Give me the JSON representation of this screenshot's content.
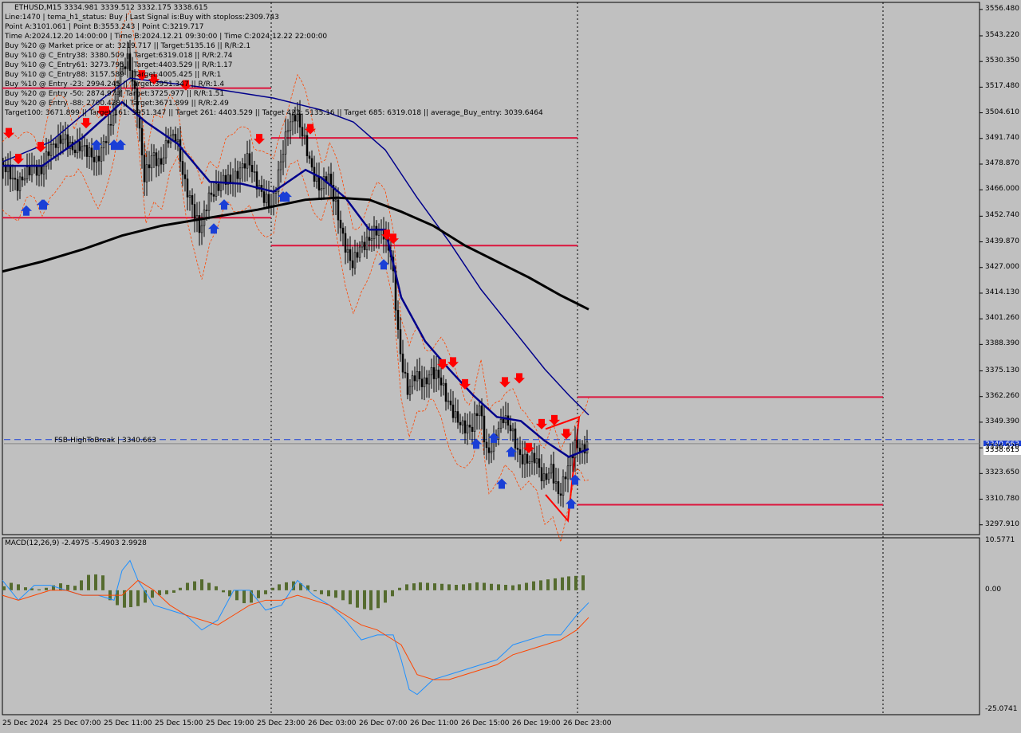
{
  "header": {
    "symbol_line": "ETHUSD,M15  3334.981 3339.512 3332.175 3338.615",
    "info_lines": [
      "Line:1470 | tema_h1_status: Buy | Last Signal is:Buy with stoploss:2309.743",
      "Point A:3101.061 | Point B:3553.243 | Point C:3219.717",
      "Time A:2024.12.20 14:00:00 | Time B:2024.12.21 09:30:00 | Time C:2024.12.22 22:00:00",
      "Buy %20 @ Market price or at: 3219.717 || Target:5135.16 || R/R:2.1",
      "Buy %10 @ C_Entry38: 3380.509 || Target:6319.018 || R/R:2.74",
      "Buy %10 @ C_Entry61: 3273.795 || Target:4403.529 || R/R:1.17",
      "Buy %10 @ C_Entry88: 3157.589 || Target:4005.425 || R/R:1",
      "Buy %10 @ Entry -23: 2994.245 || Target:3951.347 || R/R:1.4",
      "Buy %20 @ Entry -50: 2874.97 || Target:3725.977 || R/R:1.51",
      "Buy %20 @ Entry -88: 2700.428 || Target:3671.899 || R/R:2.49",
      "Target100: 3671.899 || Target 161: 3951.347 || Target 261: 4403.529 || Target 423: 5135.16 || Target 685: 6319.018 || average_Buy_entry: 3039.6464"
    ]
  },
  "macd_label": "MACD(12,26,9) -2.4975 -5.4903 2.9928",
  "hline_label": "FSB-HighToBreak | 3340.663",
  "price_tags": {
    "fsb": "3340.663",
    "current": "3338.615"
  },
  "colors": {
    "background": "#c0c0c0",
    "candles": "#000000",
    "ema_fast": "#00008b",
    "ema_slow": "#000000",
    "envelope": "#ff4500",
    "levels": "#dc143c",
    "fsb_line": "#1a3fd6",
    "macd_hist": "#556b2f",
    "macd_line": "#1e90ff",
    "signal_line": "#ff4500",
    "arrow_buy": "#1a3fd6",
    "arrow_sell": "#ff0000"
  },
  "chart_data": {
    "type": "candlestick",
    "symbol": "ETHUSD",
    "timeframe": "M15",
    "price_axis_ticks": [
      "3556.480",
      "3543.220",
      "3530.350",
      "3517.480",
      "3504.610",
      "3491.740",
      "3478.870",
      "3466.000",
      "3452.740",
      "3439.870",
      "3427.000",
      "3414.130",
      "3401.260",
      "3388.390",
      "3375.130",
      "3362.260",
      "3349.390",
      "3336.520",
      "3323.650",
      "3310.780",
      "3297.910"
    ],
    "price_range": [
      3293,
      3560
    ],
    "time_axis_ticks": [
      "25 Dec 2024",
      "25 Dec 07:00",
      "25 Dec 11:00",
      "25 Dec 15:00",
      "25 Dec 19:00",
      "25 Dec 23:00",
      "26 Dec 03:00",
      "26 Dec 07:00",
      "26 Dec 11:00",
      "26 Dec 15:00",
      "26 Dec 19:00",
      "26 Dec 23:00"
    ],
    "price_path": [
      [
        0,
        3480
      ],
      [
        10,
        3475
      ],
      [
        20,
        3468
      ],
      [
        30,
        3473
      ],
      [
        40,
        3478
      ],
      [
        50,
        3474
      ],
      [
        60,
        3486
      ],
      [
        70,
        3490
      ],
      [
        80,
        3492
      ],
      [
        90,
        3486
      ],
      [
        100,
        3488
      ],
      [
        110,
        3485
      ],
      [
        120,
        3480
      ],
      [
        130,
        3490
      ],
      [
        140,
        3502
      ],
      [
        150,
        3525
      ],
      [
        160,
        3532
      ],
      [
        170,
        3510
      ],
      [
        180,
        3472
      ],
      [
        190,
        3484
      ],
      [
        200,
        3478
      ],
      [
        210,
        3492
      ],
      [
        220,
        3493
      ],
      [
        230,
        3470
      ],
      [
        240,
        3458
      ],
      [
        250,
        3445
      ],
      [
        260,
        3462
      ],
      [
        270,
        3466
      ],
      [
        280,
        3472
      ],
      [
        290,
        3470
      ],
      [
        300,
        3476
      ],
      [
        310,
        3482
      ],
      [
        320,
        3470
      ],
      [
        330,
        3462
      ],
      [
        340,
        3458
      ],
      [
        350,
        3478
      ],
      [
        360,
        3498
      ],
      [
        370,
        3504
      ],
      [
        380,
        3492
      ],
      [
        390,
        3476
      ],
      [
        400,
        3466
      ],
      [
        410,
        3474
      ],
      [
        420,
        3458
      ],
      [
        430,
        3440
      ],
      [
        440,
        3428
      ],
      [
        450,
        3437
      ],
      [
        460,
        3440
      ],
      [
        470,
        3446
      ],
      [
        480,
        3444
      ],
      [
        490,
        3432
      ],
      [
        500,
        3385
      ],
      [
        510,
        3365
      ],
      [
        520,
        3374
      ],
      [
        530,
        3368
      ],
      [
        540,
        3375
      ],
      [
        550,
        3372
      ],
      [
        560,
        3360
      ],
      [
        570,
        3352
      ],
      [
        580,
        3347
      ],
      [
        590,
        3346
      ],
      [
        600,
        3358
      ],
      [
        610,
        3332
      ],
      [
        620,
        3342
      ],
      [
        630,
        3352
      ],
      [
        640,
        3346
      ],
      [
        650,
        3332
      ],
      [
        660,
        3330
      ],
      [
        670,
        3332
      ],
      [
        680,
        3320
      ],
      [
        690,
        3326
      ],
      [
        700,
        3312
      ],
      [
        710,
        3326
      ],
      [
        720,
        3338
      ],
      [
        730,
        3335
      ],
      [
        735,
        3338.615
      ]
    ],
    "levels": [
      3517,
      3492,
      3452,
      3438,
      3362,
      3308
    ],
    "fsb_high_to_break": 3340.663,
    "current_price": 3338.615,
    "ema_fast_path": [
      [
        0,
        3478
      ],
      [
        50,
        3478
      ],
      [
        100,
        3492
      ],
      [
        150,
        3510
      ],
      [
        180,
        3500
      ],
      [
        220,
        3489
      ],
      [
        260,
        3470
      ],
      [
        300,
        3469
      ],
      [
        340,
        3465
      ],
      [
        380,
        3476
      ],
      [
        400,
        3472
      ],
      [
        430,
        3462
      ],
      [
        460,
        3446
      ],
      [
        480,
        3446
      ],
      [
        500,
        3412
      ],
      [
        530,
        3390
      ],
      [
        560,
        3376
      ],
      [
        590,
        3363
      ],
      [
        620,
        3352
      ],
      [
        650,
        3350
      ],
      [
        680,
        3340
      ],
      [
        710,
        3332
      ],
      [
        735,
        3336
      ]
    ],
    "ema_slow_path": [
      [
        0,
        3425
      ],
      [
        50,
        3430
      ],
      [
        100,
        3436
      ],
      [
        150,
        3443
      ],
      [
        200,
        3448
      ],
      [
        260,
        3452
      ],
      [
        320,
        3456
      ],
      [
        380,
        3461
      ],
      [
        420,
        3462
      ],
      [
        460,
        3461
      ],
      [
        500,
        3455
      ],
      [
        540,
        3448
      ],
      [
        580,
        3438
      ],
      [
        620,
        3430
      ],
      [
        660,
        3422
      ],
      [
        700,
        3413
      ],
      [
        735,
        3406
      ]
    ],
    "ema_mid_path": [
      [
        0,
        3480
      ],
      [
        60,
        3490
      ],
      [
        120,
        3510
      ],
      [
        160,
        3522
      ],
      [
        200,
        3520
      ],
      [
        260,
        3517
      ],
      [
        340,
        3512
      ],
      [
        400,
        3506
      ],
      [
        440,
        3500
      ],
      [
        480,
        3486
      ],
      [
        520,
        3462
      ],
      [
        560,
        3440
      ],
      [
        600,
        3416
      ],
      [
        640,
        3396
      ],
      [
        680,
        3376
      ],
      [
        710,
        3363
      ],
      [
        735,
        3353
      ]
    ],
    "sell_arrows": [
      [
        8,
        3493
      ],
      [
        20,
        3480
      ],
      [
        48,
        3486
      ],
      [
        105,
        3498
      ],
      [
        125,
        3504
      ],
      [
        130,
        3504
      ],
      [
        175,
        3522
      ],
      [
        190,
        3520
      ],
      [
        230,
        3517
      ],
      [
        322,
        3490
      ],
      [
        386,
        3495
      ],
      [
        482,
        3442
      ],
      [
        490,
        3440
      ],
      [
        552,
        3377
      ],
      [
        565,
        3378
      ],
      [
        580,
        3367
      ],
      [
        630,
        3368
      ],
      [
        648,
        3370
      ],
      [
        660,
        3335
      ],
      [
        676,
        3347
      ],
      [
        692,
        3349
      ],
      [
        707,
        3342
      ]
    ],
    "buy_arrows": [
      [
        30,
        3457
      ],
      [
        50,
        3460
      ],
      [
        52,
        3460
      ],
      [
        118,
        3490
      ],
      [
        140,
        3490
      ],
      [
        148,
        3490
      ],
      [
        265,
        3448
      ],
      [
        278,
        3460
      ],
      [
        352,
        3464
      ],
      [
        356,
        3464
      ],
      [
        478,
        3430
      ],
      [
        594,
        3340
      ],
      [
        616,
        3343
      ],
      [
        626,
        3320
      ],
      [
        638,
        3336
      ],
      [
        713,
        3310
      ],
      [
        718,
        3322
      ]
    ],
    "macd": {
      "ylim": [
        -25.0741,
        10.5771
      ],
      "axis_ticks": [
        "10.5771",
        "0.00",
        "-25.0741"
      ],
      "macd_path": [
        [
          0,
          2
        ],
        [
          20,
          -2
        ],
        [
          40,
          1
        ],
        [
          60,
          1
        ],
        [
          80,
          0
        ],
        [
          100,
          -1
        ],
        [
          120,
          -1
        ],
        [
          140,
          -2
        ],
        [
          150,
          4
        ],
        [
          160,
          6
        ],
        [
          170,
          2
        ],
        [
          190,
          -3
        ],
        [
          210,
          -4
        ],
        [
          230,
          -5
        ],
        [
          250,
          -8
        ],
        [
          270,
          -6
        ],
        [
          290,
          0
        ],
        [
          310,
          0
        ],
        [
          330,
          -4
        ],
        [
          350,
          -3
        ],
        [
          370,
          2
        ],
        [
          390,
          -1
        ],
        [
          410,
          -3
        ],
        [
          430,
          -6
        ],
        [
          450,
          -10
        ],
        [
          470,
          -9
        ],
        [
          490,
          -9
        ],
        [
          500,
          -14
        ],
        [
          510,
          -20
        ],
        [
          520,
          -21
        ],
        [
          540,
          -18
        ],
        [
          560,
          -17
        ],
        [
          580,
          -16
        ],
        [
          600,
          -15
        ],
        [
          620,
          -14
        ],
        [
          640,
          -11
        ],
        [
          660,
          -10
        ],
        [
          680,
          -9
        ],
        [
          700,
          -9
        ],
        [
          720,
          -5
        ],
        [
          735,
          -2.4975
        ]
      ],
      "signal_path": [
        [
          0,
          -1
        ],
        [
          20,
          -2
        ],
        [
          40,
          -1
        ],
        [
          60,
          0
        ],
        [
          80,
          0
        ],
        [
          100,
          -1
        ],
        [
          120,
          -1
        ],
        [
          150,
          -1
        ],
        [
          170,
          2
        ],
        [
          190,
          0
        ],
        [
          210,
          -3
        ],
        [
          230,
          -5
        ],
        [
          250,
          -6
        ],
        [
          270,
          -7
        ],
        [
          290,
          -5
        ],
        [
          310,
          -3
        ],
        [
          330,
          -2
        ],
        [
          350,
          -2
        ],
        [
          370,
          -1
        ],
        [
          390,
          -2
        ],
        [
          410,
          -3
        ],
        [
          430,
          -5
        ],
        [
          450,
          -7
        ],
        [
          470,
          -8
        ],
        [
          490,
          -10
        ],
        [
          500,
          -11
        ],
        [
          510,
          -14
        ],
        [
          520,
          -17
        ],
        [
          540,
          -18
        ],
        [
          560,
          -18
        ],
        [
          580,
          -17
        ],
        [
          600,
          -16
        ],
        [
          620,
          -15
        ],
        [
          640,
          -13
        ],
        [
          660,
          -12
        ],
        [
          680,
          -11
        ],
        [
          700,
          -10
        ],
        [
          720,
          -8
        ],
        [
          735,
          -5.4903
        ]
      ],
      "hist_values": [
        0.8,
        1.5,
        1.2,
        0.6,
        0.4,
        0.2,
        0.5,
        1.0,
        1.4,
        1.1,
        0.9,
        2.0,
        3.1,
        3.2,
        3.0,
        -2.0,
        -3.0,
        -3.5,
        -3.4,
        -3.2,
        -2.5,
        -1.5,
        -1.0,
        -0.8,
        -0.5,
        0.5,
        1.5,
        1.8,
        2.2,
        1.5,
        0.8,
        -0.4,
        -1.2,
        -2.0,
        -2.6,
        -2.5,
        -1.6,
        -0.8,
        0.5,
        1.2,
        1.6,
        1.8,
        1.4,
        1.0,
        -0.2,
        -0.8,
        -1.2,
        -1.5,
        -2.0,
        -2.8,
        -3.5,
        -3.8,
        -4.0,
        -3.6,
        -2.5,
        -1.2,
        0.5,
        1.2,
        1.4,
        1.6,
        1.5,
        1.4,
        1.3,
        1.2,
        1.1,
        1.2,
        1.4,
        1.6,
        1.5,
        1.3,
        1.2,
        1.1,
        1.0,
        1.2,
        1.5,
        1.8,
        2.0,
        2.2,
        2.4,
        2.6,
        2.8,
        2.9,
        3.0
      ]
    }
  }
}
